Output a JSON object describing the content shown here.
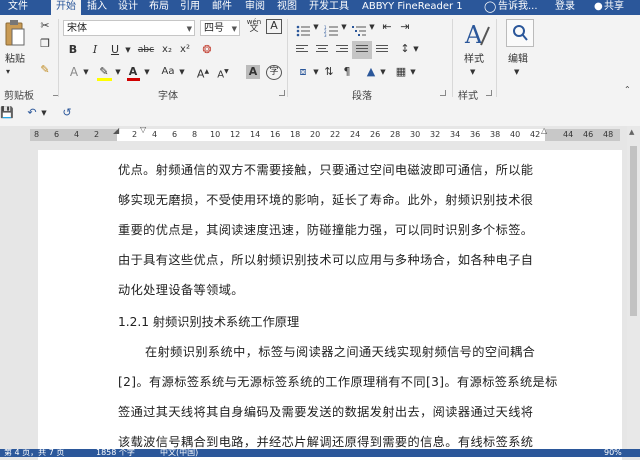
{
  "menubar": {
    "tabs": [
      "文件",
      "开始",
      "插入",
      "设计",
      "布局",
      "引用",
      "邮件",
      "审阅",
      "视图",
      "开发工具",
      "ABBYY FineReader 1"
    ],
    "active_tab": "开始",
    "tell_me": "告诉我...",
    "login": "登录",
    "share": "共享"
  },
  "ribbon": {
    "clipboard": {
      "paste": "粘贴",
      "label": "剪贴板"
    },
    "font": {
      "family": "宋体",
      "size": "四号",
      "wen": "wén",
      "wen_char": "文",
      "a_box": "A",
      "bold": "B",
      "italic": "I",
      "underline": "U",
      "strike": "abc",
      "sub": "x₂",
      "sup": "x²",
      "aa": "Aa",
      "grow": "A",
      "shrink": "A",
      "label": "字体"
    },
    "paragraph": {
      "label": "段落"
    },
    "styles": {
      "button": "样式",
      "label": "样式"
    },
    "editing": {
      "button": "编辑"
    }
  },
  "ruler": {
    "left_ticks": [
      "8",
      "6",
      "4",
      "2"
    ],
    "right_ticks": [
      "2",
      "4",
      "6",
      "8",
      "10",
      "12",
      "14",
      "16",
      "18",
      "20",
      "22",
      "24",
      "26",
      "28",
      "30",
      "32",
      "34",
      "36",
      "38",
      "40",
      "42"
    ],
    "tail_ticks": [
      "44",
      "46",
      "48"
    ]
  },
  "document": {
    "lines": [
      "优点。射频通信的双方不需要接触，只要通过空间电磁波即可通信，所以能",
      "够实现无磨损，不受使用环境的影响，延长了寿命。此外，射频识别技术很",
      "重要的优点是，其阅读速度迅速，防碰撞能力强，可以同时识别多个标签。",
      "由于具有这些优点，所以射频识别技术可以应用与多种场合，如各种电子自",
      "动化处理设备等领域。"
    ],
    "heading": "1.2.1 射频识别技术系统工作原理",
    "para2": [
      "在射频识别系统中，标签与阅读器之间通天线实现射频信号的空间耦合",
      "[2]。有源标签系统与无源标签系统的工作原理稍有不同[3]。有源标签系统是标",
      "签通过其天线将其自身编码及需要发送的数据发射出去，阅读器通过天线将",
      "该载波信号耦合到电路，并经芯片解调还原得到需要的信息。有线标签系统"
    ]
  },
  "statusbar": {
    "page": "第 4 页，共 7 页",
    "words": "1858 个字",
    "lang": "中文(中国)",
    "zoom": "90%"
  },
  "colors": {
    "accent": "#2b579a",
    "highlight": "#ffff00",
    "font_color": "#d00000"
  }
}
